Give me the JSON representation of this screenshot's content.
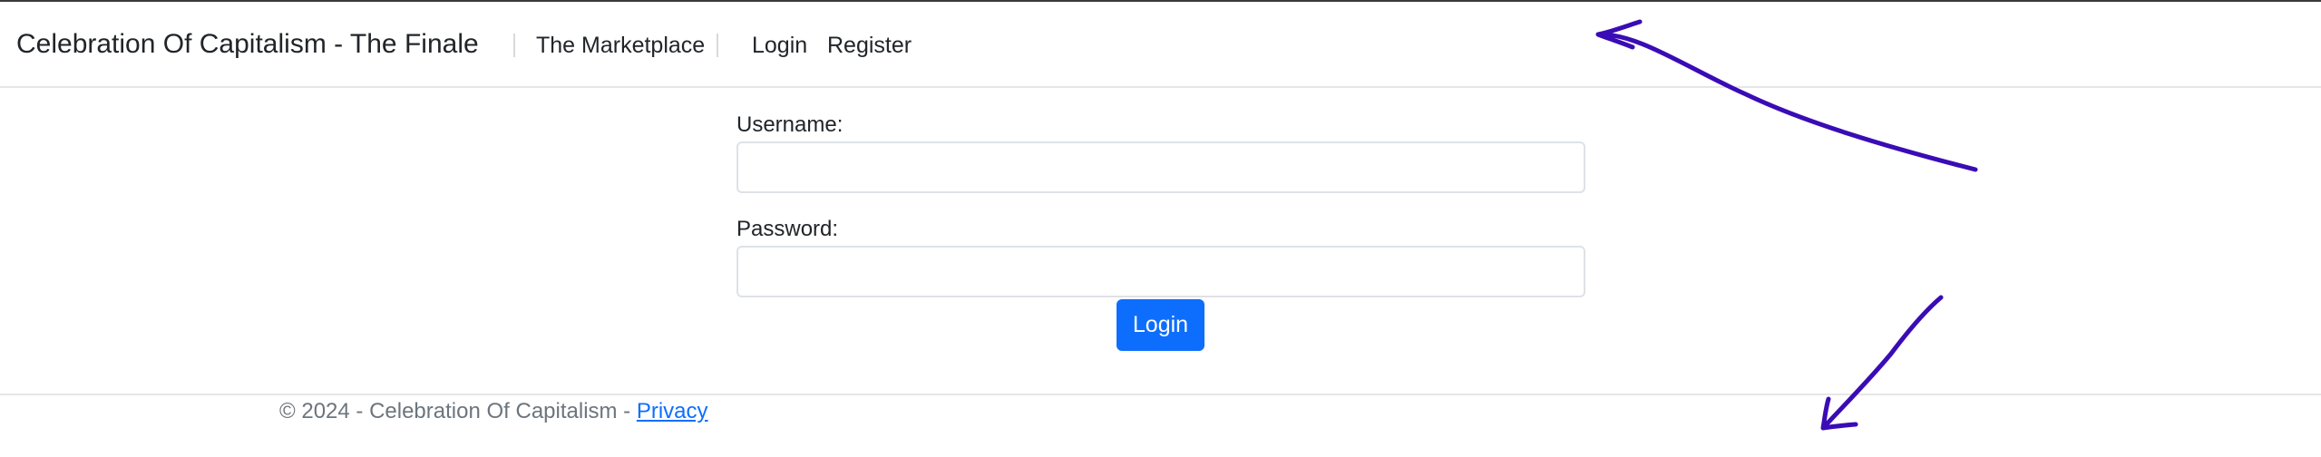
{
  "navbar": {
    "brand": "Celebration Of Capitalism - The Finale",
    "links": [
      {
        "label": "The Marketplace"
      },
      {
        "label": "Login"
      },
      {
        "label": "Register"
      }
    ]
  },
  "form": {
    "username_label": "Username:",
    "username_value": "",
    "password_label": "Password:",
    "password_value": "",
    "submit_label": "Login"
  },
  "footer": {
    "text": "© 2024 - Celebration Of Capitalism - ",
    "link": "Privacy"
  },
  "colors": {
    "primary": "#0d6efd",
    "annotation": "#3a0cb5",
    "footer_text": "#6c757d"
  },
  "annotations": [
    {
      "type": "arrow",
      "icon": "hand-drawn-arrow-icon"
    },
    {
      "type": "arrow",
      "icon": "hand-drawn-arrow-icon"
    }
  ]
}
